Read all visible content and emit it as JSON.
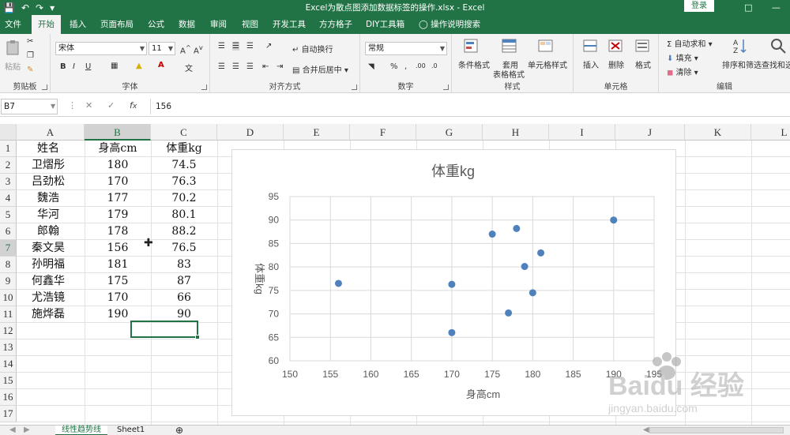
{
  "window": {
    "title": "Excel为散点图添加数据标签的操作.xlsx  -  Excel",
    "login_label": "登录"
  },
  "tabs": [
    "文件",
    "开始",
    "插入",
    "页面布局",
    "公式",
    "数据",
    "审阅",
    "视图",
    "开发工具",
    "方方格子",
    "DIY工具箱"
  ],
  "tell_me": "操作说明搜索",
  "ribbon": {
    "clipboard": {
      "paste": "粘贴",
      "label": "剪贴板"
    },
    "font": {
      "name": "宋体",
      "size": "11",
      "label": "字体",
      "bold": "B",
      "italic": "I",
      "underline": "U"
    },
    "alignment": {
      "wrap": "自动换行",
      "merge": "合并后居中",
      "label": "对齐方式"
    },
    "number": {
      "format": "常规",
      "percent": "%",
      "comma": ",",
      "label": "数字"
    },
    "styles": {
      "conditional": "条件格式",
      "table_fmt_1": "套用",
      "table_fmt_2": "表格格式",
      "cell_style": "单元格样式",
      "label": "样式"
    },
    "cells": {
      "insert": "插入",
      "delete": "删除",
      "format": "格式",
      "label": "单元格"
    },
    "editing": {
      "autosum": "自动求和",
      "fill": "填充",
      "clear": "清除",
      "sort": "排序和筛选",
      "find": "查找和选",
      "label": "编辑"
    }
  },
  "formula_bar": {
    "name_box": "B7",
    "formula": "156"
  },
  "columns": [
    "A",
    "B",
    "C",
    "D",
    "E",
    "F",
    "G",
    "H",
    "I",
    "J",
    "K",
    "L"
  ],
  "rows": [
    "1",
    "2",
    "3",
    "4",
    "5",
    "6",
    "7",
    "8",
    "9",
    "10",
    "11",
    "12",
    "13",
    "14",
    "15",
    "16",
    "17"
  ],
  "table": {
    "headers": [
      "姓名",
      "身高cm",
      "体重kg"
    ],
    "rows": [
      [
        "卫熠彤",
        "180",
        "74.5"
      ],
      [
        "吕劲松",
        "170",
        "76.3"
      ],
      [
        "魏浩",
        "177",
        "70.2"
      ],
      [
        "华河",
        "179",
        "80.1"
      ],
      [
        "郎翰",
        "178",
        "88.2"
      ],
      [
        "秦文昊",
        "156",
        "76.5"
      ],
      [
        "孙明福",
        "181",
        "83"
      ],
      [
        "何鑫华",
        "175",
        "87"
      ],
      [
        "尤浩镜",
        "170",
        "66"
      ],
      [
        "施烨磊",
        "190",
        "90"
      ]
    ]
  },
  "sheets": [
    "线性趋势线",
    "Sheet1"
  ],
  "chart_data": {
    "type": "scatter",
    "title": "体重kg",
    "xlabel": "身高cm",
    "ylabel": "体重kg",
    "xlim": [
      150,
      195
    ],
    "ylim": [
      60,
      95
    ],
    "x_ticks": [
      "150",
      "155",
      "160",
      "165",
      "170",
      "175",
      "180",
      "185",
      "190",
      "195"
    ],
    "y_ticks": [
      "60",
      "65",
      "70",
      "75",
      "80",
      "85",
      "90",
      "95"
    ],
    "grid": true,
    "series": [
      {
        "color": "#4f81bd",
        "x": [
          180,
          170,
          177,
          179,
          178,
          156,
          181,
          175,
          170,
          190
        ],
        "y": [
          74.5,
          76.3,
          70.2,
          80.1,
          88.2,
          76.5,
          83,
          87,
          66,
          90
        ]
      }
    ]
  },
  "colors": {
    "accent": "#217346",
    "marker": "#4f81bd"
  },
  "watermark": {
    "brand": "Baidu 经验",
    "url": "jingyan.baidu.com"
  }
}
